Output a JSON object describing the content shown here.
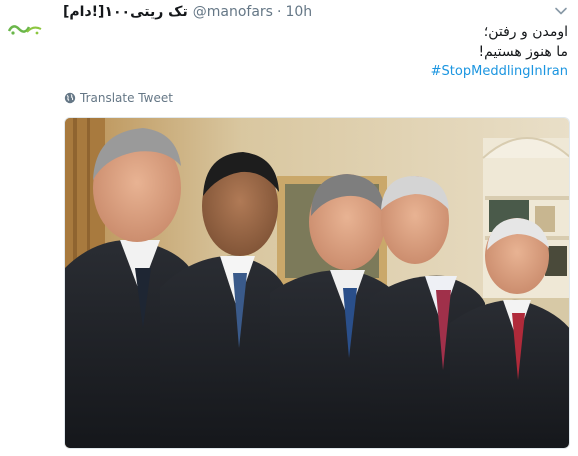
{
  "tweet": {
    "display_name": "[دام!]تک ریتی۱۰۰",
    "handle": "@manofars",
    "separator": "·",
    "time": "10h",
    "text_line1": "اومدن و رفتن؛",
    "text_line2": "ما هنوز هستیم!",
    "hashtag": "#StopMeddlingInIran",
    "translate_label": "Translate Tweet"
  },
  "media": {
    "alt": "Photo of five men in suits standing in a row in an office"
  },
  "icons": {
    "avatar": "avatar-logo-icon",
    "caret": "chevron-down-icon",
    "translate": "globe-icon"
  },
  "colors": {
    "link": "#1b95e0",
    "muted": "#657786",
    "text": "#14171a",
    "avatar_green": "#6ab64a"
  }
}
